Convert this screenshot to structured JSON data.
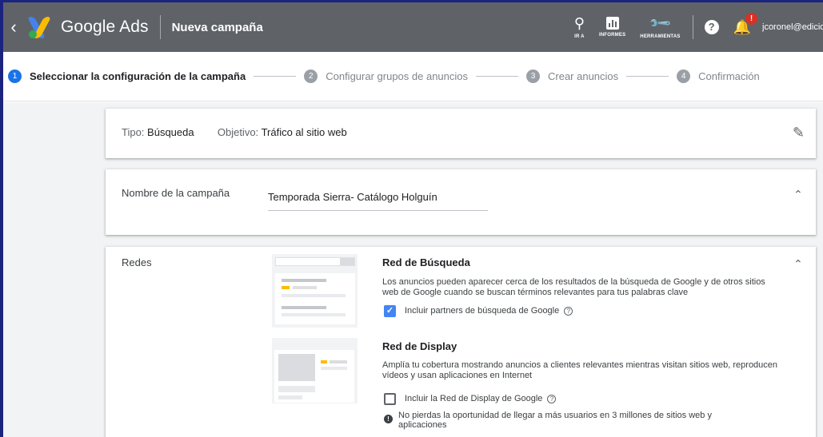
{
  "header": {
    "app_name": "Google Ads",
    "page_title": "Nueva campaña",
    "back_icon": "chevron-left-icon",
    "tools": [
      {
        "label": "IR A",
        "icon": "search-icon"
      },
      {
        "label": "INFORMES",
        "icon": "reports-icon"
      },
      {
        "label": "HERRAMIENTAS",
        "icon": "wrench-icon"
      }
    ],
    "help_icon": "help-icon",
    "notifications_badge": "!",
    "user_email": "jcoronel@edicio"
  },
  "stepper": [
    {
      "num": "1",
      "label": "Seleccionar la configuración de la campaña",
      "active": true
    },
    {
      "num": "2",
      "label": "Configurar grupos de anuncios",
      "active": false
    },
    {
      "num": "3",
      "label": "Crear anuncios",
      "active": false
    },
    {
      "num": "4",
      "label": "Confirmación",
      "active": false
    }
  ],
  "summary": {
    "type_label": "Tipo:",
    "type_value": "Búsqueda",
    "goal_label": "Objetivo:",
    "goal_value": "Tráfico al sitio web"
  },
  "campaign_name": {
    "label": "Nombre de la campaña",
    "value": "Temporada Sierra- Catálogo Holguín"
  },
  "networks": {
    "label": "Redes",
    "search": {
      "title": "Red de Búsqueda",
      "description": "Los anuncios pueden aparecer cerca de los resultados de la búsqueda de Google y de otros sitios web de Google cuando se buscan términos relevantes para tus palabras clave",
      "checkbox_label": "Incluir partners de búsqueda de Google",
      "checked": true
    },
    "display": {
      "title": "Red de Display",
      "description": "Amplía tu cobertura mostrando anuncios a clientes relevantes mientras visitan sitios web, reproducen vídeos y usan aplicaciones en Internet",
      "checkbox_label": "Incluir la Red de Display de Google",
      "checked": false,
      "info": "No pierdas la oportunidad de llegar a más usuarios en 3 millones de sitios web y aplicaciones"
    }
  },
  "colors": {
    "header_bg": "#5f6368",
    "accent": "#1a73e8",
    "checkbox_checked": "#4285f4",
    "notification": "#d93025"
  }
}
